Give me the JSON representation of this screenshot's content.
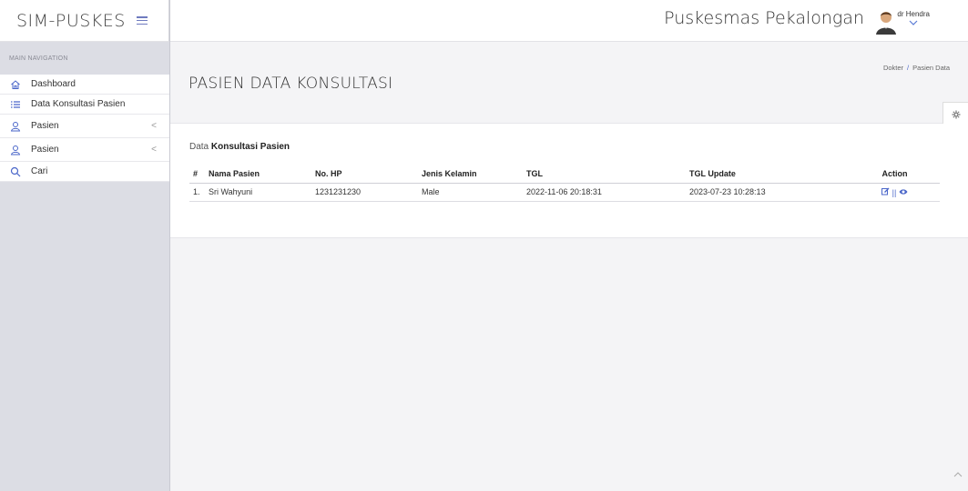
{
  "brand": {
    "title": "SIM-PUSKES",
    "menu_icon": "hamburger-icon"
  },
  "topbar": {
    "hospital": "Puskesmas Pekalongan",
    "user": "dr Hendra",
    "caret_icon": "chevron-down-icon"
  },
  "sidebar": {
    "header": "MAIN NAVIGATION",
    "items": [
      {
        "label": "Dashboard",
        "icon": "home-icon"
      },
      {
        "label": "Data Konsultasi Pasien",
        "icon": "list-icon"
      },
      {
        "label": "Pasien",
        "icon": "user-icon",
        "chevron": "<"
      },
      {
        "label": "Pasien",
        "icon": "user-icon",
        "chevron": "<"
      },
      {
        "label": "Cari",
        "icon": "search-icon"
      }
    ]
  },
  "page": {
    "title": "PASIEN DATA KONSULTASI",
    "breadcrumb": {
      "first": "Dokter",
      "sep": "/",
      "second": "Pasien Data"
    }
  },
  "panel": {
    "title_prefix": "Data",
    "title_bold": "Konsultasi Pasien"
  },
  "table": {
    "headers": {
      "num": "#",
      "nama": "Nama Pasien",
      "hp": "No. HP",
      "jk": "Jenis Kelamin",
      "tgl": "TGL",
      "upd": "TGL Update",
      "act": "Action"
    },
    "rows": [
      {
        "num": "1.",
        "nama": "Sri Wahyuni",
        "hp": "1231231230",
        "jk": "Male",
        "tgl": "2022-11-06 20:18:31",
        "upd": "2023-07-23 10:28:13"
      }
    ],
    "action_sep": "||"
  },
  "colors": {
    "accent": "#4a66c9",
    "sidebar_bg": "#dcdde4",
    "page_bg": "#f4f4f6"
  }
}
